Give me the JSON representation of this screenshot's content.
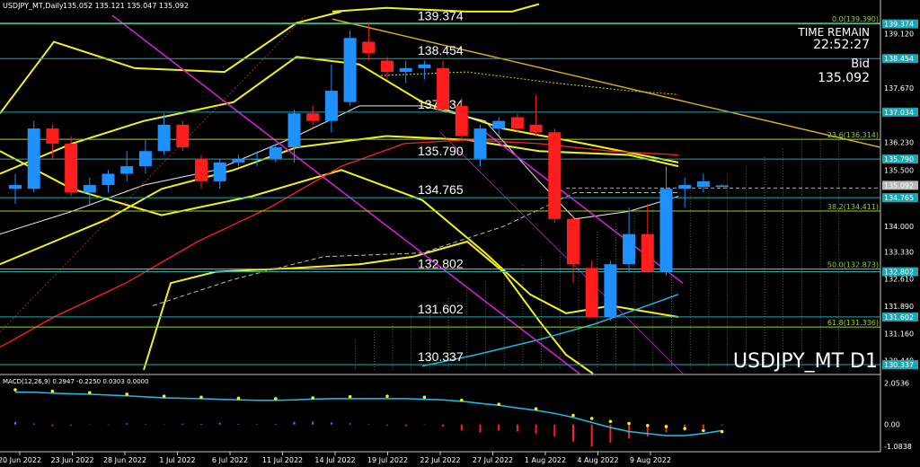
{
  "header": {
    "symbol_line": "USDJPY_MT,Daily",
    "ohlc_line": "135.052 135.121 135.047 135.092"
  },
  "info_panel": {
    "time_remain_label": "TIME REMAIN",
    "time_remain_value": "22:52:27",
    "bid_label": "Bid",
    "bid_value": "135.092"
  },
  "watermark": "USDJPY_MT D1",
  "chart_data": {
    "type": "candlestick",
    "y_range": [
      130.1,
      139.65
    ],
    "y_axis_labels": [
      "139.120",
      "138.454",
      "137.670",
      "137.034",
      "136.230",
      "135.790",
      "135.500",
      "135.092",
      "134.765",
      "134.000",
      "133.330",
      "132.802",
      "132.610",
      "131.890",
      "131.602",
      "131.160",
      "130.440",
      "130.337"
    ],
    "highlighted_axis_labels": {
      "139.374": "#1fa6b3",
      "138.454": "#1fa6b3",
      "137.034": "#1fa6b3",
      "135.790": "#1fa6b3",
      "135.092": "#b8b8b8",
      "134.765": "#1fa6b3",
      "132.802": "#1fa6b3",
      "131.602": "#1fa6b3",
      "130.337": "#1fa6b3"
    },
    "levels": [
      "139.374",
      "138.454",
      "137.034",
      "135.790",
      "134.765",
      "132.802",
      "131.602",
      "130.337"
    ],
    "fibonacci": [
      {
        "ratio": "0.0",
        "price": "139.390"
      },
      {
        "ratio": "23.6",
        "price": "136.314"
      },
      {
        "ratio": "38.2",
        "price": "134.411"
      },
      {
        "ratio": "50.0",
        "price": "132.873"
      },
      {
        "ratio": "61.8",
        "price": "131.336"
      }
    ],
    "x_labels": [
      "20 Jun 2022",
      "23 Jun 2022",
      "28 Jun 2022",
      "1 Jul 2022",
      "6 Jul 2022",
      "11 Jul 2022",
      "14 Jul 2022",
      "19 Jul 2022",
      "22 Jul 2022",
      "27 Jul 2022",
      "1 Aug 2022",
      "4 Aug 2022",
      "9 Aug 2022"
    ],
    "candles": [
      {
        "o": 135.0,
        "h": 135.4,
        "l": 134.6,
        "c": 135.1
      },
      {
        "o": 135.0,
        "h": 136.8,
        "l": 134.9,
        "c": 136.6
      },
      {
        "o": 136.6,
        "h": 136.7,
        "l": 135.8,
        "c": 136.2
      },
      {
        "o": 136.2,
        "h": 136.4,
        "l": 134.8,
        "c": 134.9
      },
      {
        "o": 134.9,
        "h": 135.3,
        "l": 134.6,
        "c": 135.1
      },
      {
        "o": 135.1,
        "h": 135.5,
        "l": 134.9,
        "c": 135.4
      },
      {
        "o": 135.4,
        "h": 136.0,
        "l": 135.2,
        "c": 135.6
      },
      {
        "o": 135.6,
        "h": 136.3,
        "l": 135.4,
        "c": 136.0
      },
      {
        "o": 136.0,
        "h": 137.0,
        "l": 135.9,
        "c": 136.7
      },
      {
        "o": 136.7,
        "h": 136.8,
        "l": 136.0,
        "c": 136.1
      },
      {
        "o": 135.8,
        "h": 135.9,
        "l": 135.0,
        "c": 135.2
      },
      {
        "o": 135.2,
        "h": 135.8,
        "l": 135.0,
        "c": 135.7
      },
      {
        "o": 135.7,
        "h": 135.9,
        "l": 135.6,
        "c": 135.8
      },
      {
        "o": 135.8,
        "h": 136.0,
        "l": 135.6,
        "c": 135.8
      },
      {
        "o": 135.8,
        "h": 136.2,
        "l": 135.7,
        "c": 136.1
      },
      {
        "o": 136.1,
        "h": 137.1,
        "l": 135.7,
        "c": 137.0
      },
      {
        "o": 137.0,
        "h": 137.2,
        "l": 136.7,
        "c": 136.8
      },
      {
        "o": 136.8,
        "h": 138.3,
        "l": 136.5,
        "c": 137.6
      },
      {
        "o": 137.3,
        "h": 139.2,
        "l": 137.2,
        "c": 139.0
      },
      {
        "o": 138.9,
        "h": 139.38,
        "l": 138.4,
        "c": 138.6
      },
      {
        "o": 138.4,
        "h": 138.5,
        "l": 137.9,
        "c": 138.1
      },
      {
        "o": 138.1,
        "h": 138.4,
        "l": 137.8,
        "c": 138.2
      },
      {
        "o": 138.2,
        "h": 138.4,
        "l": 137.9,
        "c": 138.3
      },
      {
        "o": 138.2,
        "h": 138.4,
        "l": 137.2,
        "c": 137.1
      },
      {
        "o": 137.2,
        "h": 137.4,
        "l": 136.3,
        "c": 136.4
      },
      {
        "o": 135.8,
        "h": 136.7,
        "l": 135.6,
        "c": 136.6
      },
      {
        "o": 136.6,
        "h": 136.9,
        "l": 136.4,
        "c": 136.8
      },
      {
        "o": 136.9,
        "h": 137.0,
        "l": 136.5,
        "c": 136.6
      },
      {
        "o": 136.7,
        "h": 137.5,
        "l": 136.4,
        "c": 136.5
      },
      {
        "o": 136.5,
        "h": 136.6,
        "l": 134.1,
        "c": 134.2
      },
      {
        "o": 134.2,
        "h": 134.3,
        "l": 132.5,
        "c": 133.0
      },
      {
        "o": 132.9,
        "h": 133.1,
        "l": 131.6,
        "c": 131.6
      },
      {
        "o": 131.6,
        "h": 133.1,
        "l": 131.5,
        "c": 133.0
      },
      {
        "o": 133.0,
        "h": 134.5,
        "l": 132.8,
        "c": 133.8
      },
      {
        "o": 133.8,
        "h": 134.6,
        "l": 132.8,
        "c": 132.8
      },
      {
        "o": 132.8,
        "h": 135.6,
        "l": 132.7,
        "c": 135.0
      },
      {
        "o": 135.0,
        "h": 135.3,
        "l": 134.5,
        "c": 135.1
      },
      {
        "o": 135.05,
        "h": 135.4,
        "l": 134.9,
        "c": 135.2
      },
      {
        "o": 135.05,
        "h": 135.12,
        "l": 135.05,
        "c": 135.09
      }
    ],
    "macd": {
      "label": "MACD(12,26,9) 0.2947 -0.2250 0.0303 0.0000",
      "y_labels": [
        "2.0536",
        "0.00",
        "-1.0838"
      ],
      "range": [
        -1.35,
        2.3
      ],
      "signal": [
        1.6,
        1.6,
        1.55,
        1.52,
        1.5,
        1.46,
        1.42,
        1.37,
        1.32,
        1.3,
        1.28,
        1.25,
        1.22,
        1.2,
        1.2,
        1.22,
        1.26,
        1.28,
        1.28,
        1.28,
        1.28,
        1.28,
        1.25,
        1.22,
        1.15,
        1.05,
        0.95,
        0.82,
        0.7,
        0.55,
        0.35,
        0.1,
        -0.15,
        -0.35,
        -0.45,
        -0.55,
        -0.55,
        -0.45,
        -0.3
      ],
      "dots": [
        1.72,
        1.7,
        1.65,
        1.6,
        1.58,
        1.55,
        1.5,
        1.45,
        1.4,
        1.38,
        1.35,
        1.32,
        1.3,
        1.28,
        1.28,
        1.3,
        1.32,
        1.35,
        1.38,
        1.38,
        1.4,
        1.38,
        1.35,
        1.3,
        1.2,
        1.1,
        1.0,
        0.9,
        0.78,
        0.62,
        0.45,
        0.3,
        0.15,
        0.05,
        -0.05,
        -0.1,
        -0.2,
        -0.3,
        -0.35
      ],
      "hist": [
        0.12,
        0.05,
        -0.08,
        -0.05,
        -0.02,
        -0.03,
        0.06,
        0.02,
        -0.02,
        0.04,
        0.03,
        0.08,
        0.03,
        0.02,
        0.03,
        0.12,
        0.14,
        0.1,
        0.06,
        0.02,
        -0.05,
        -0.08,
        -0.02,
        -0.1,
        -0.3,
        -0.4,
        -0.3,
        -0.35,
        -0.45,
        -0.6,
        -0.85,
        -1.1,
        -0.9,
        -0.7,
        -0.6,
        -0.4,
        -0.3,
        -0.2,
        -0.05
      ]
    }
  }
}
